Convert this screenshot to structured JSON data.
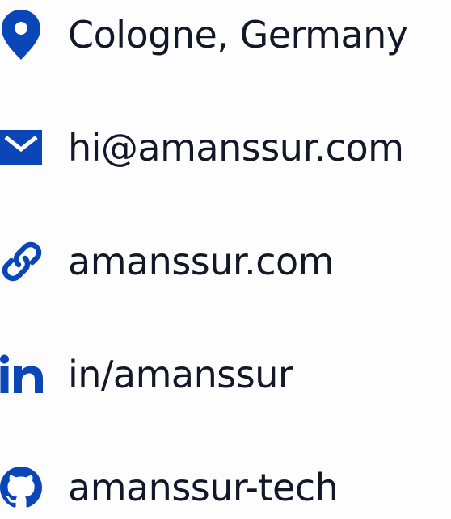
{
  "theme": {
    "icon_color": "#0b46b8",
    "text_color": "#121827",
    "background": "#fdfdfe"
  },
  "contacts": [
    {
      "icon": "map-pin-icon",
      "text": "Cologne, Germany"
    },
    {
      "icon": "envelope-icon",
      "text": "hi@amanssur.com"
    },
    {
      "icon": "link-icon",
      "text": "amanssur.com"
    },
    {
      "icon": "linkedin-icon",
      "text": "in/amanssur"
    },
    {
      "icon": "github-icon",
      "text": "amanssur-tech"
    }
  ]
}
